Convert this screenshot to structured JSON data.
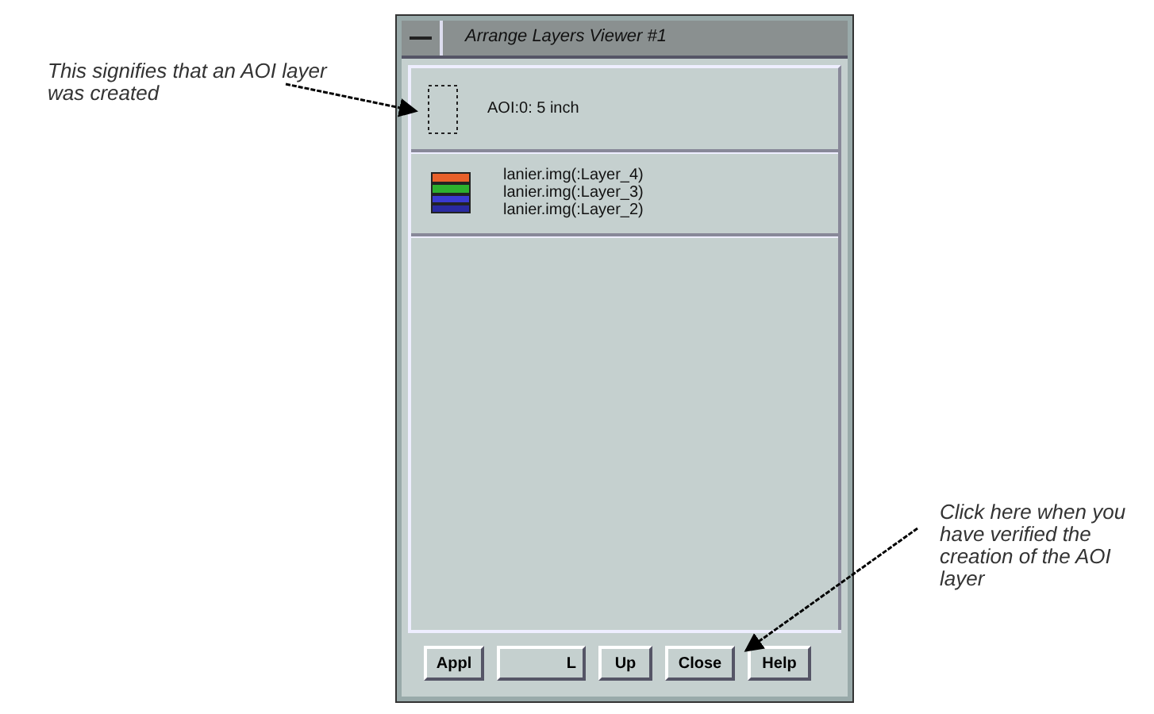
{
  "window": {
    "title": "Arrange Layers Viewer #1"
  },
  "layers": [
    {
      "kind": "aoi",
      "lines": [
        "AOI:0: 5 inch"
      ]
    },
    {
      "kind": "raster",
      "lines": [
        "lanier.img(:Layer_4)",
        "lanier.img(:Layer_3)",
        "lanier.img(:Layer_2)"
      ]
    }
  ],
  "buttons": [
    "Appl",
    "L",
    "Up",
    "Close",
    "Help"
  ],
  "annotations": [
    {
      "text": "This signifies that an AOI layer was created"
    },
    {
      "text": "Click here when you have verified the creation of the AOI layer"
    }
  ]
}
